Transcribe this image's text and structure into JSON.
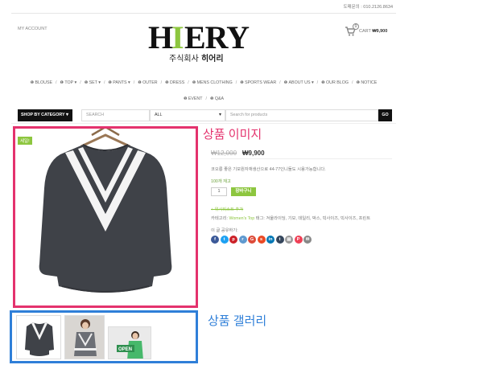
{
  "topbar": {
    "contact": "도매문의 : 010.2126.8634"
  },
  "header": {
    "my_account": "MY ACCOUNT",
    "logo_text": "HIERY",
    "logo_sub": "주식회사 히어리",
    "cart_badge": "0",
    "cart_label": "CART",
    "cart_total": "₩9,900"
  },
  "nav": {
    "items": [
      {
        "label": "BLOUSE",
        "chevron": false
      },
      {
        "label": "TOP",
        "chevron": true
      },
      {
        "label": "SET",
        "chevron": true
      },
      {
        "label": "PANTS",
        "chevron": true
      },
      {
        "label": "OUTER",
        "chevron": false
      },
      {
        "label": "DRESS",
        "chevron": false
      },
      {
        "label": "MENS CLOTHING",
        "chevron": false
      },
      {
        "label": "SPORTS WEAR",
        "chevron": false
      },
      {
        "label": "ABOUT US",
        "chevron": true
      },
      {
        "label": "OUR BLOG",
        "chevron": false
      },
      {
        "label": "NOTICE",
        "chevron": false
      },
      {
        "label": "EVENT",
        "chevron": false
      },
      {
        "label": "Q&A",
        "chevron": false
      }
    ]
  },
  "search": {
    "category_button": "SHOP BY CATEGORY",
    "search_label": "SEARCH",
    "scope": "ALL",
    "placeholder": "Search for products",
    "go": "GO"
  },
  "product": {
    "sale_badge": "세일!",
    "old_price": "₩12,000",
    "new_price": "₩9,900",
    "description": "코오롱 좋은 기모원자재생산으로 44-77인니둘도 시용가능합니다.",
    "stock": "100개 재고",
    "quantity": "1",
    "buy_button": "장바구니",
    "wishlist": "+ 위시리스트 추가",
    "categories_prefix": "카테고리: ",
    "categories_link": "Women's Top",
    "tags": " 태그: 겨울라이딩, 기모, 데일리, 박스, 빅사이즈, 빅사이즈, 프린트",
    "share_label": "이 글 공유하기:"
  },
  "social": [
    {
      "icon": "facebook-icon",
      "glyph": "f",
      "color": "#3b5998"
    },
    {
      "icon": "twitter-icon",
      "glyph": "t",
      "color": "#1da1f2"
    },
    {
      "icon": "pinterest-icon",
      "glyph": "p",
      "color": "#cb2027"
    },
    {
      "icon": "reddit-icon",
      "glyph": "r",
      "color": "#5f99cf"
    },
    {
      "icon": "googleplus-icon",
      "glyph": "G",
      "color": "#dd4b39"
    },
    {
      "icon": "stumbleupon-icon",
      "glyph": "s",
      "color": "#eb4924"
    },
    {
      "icon": "linkedin-icon",
      "glyph": "in",
      "color": "#0077b5"
    },
    {
      "icon": "tumblr-icon",
      "glyph": "t",
      "color": "#35465c"
    },
    {
      "icon": "print-icon",
      "glyph": "▤",
      "color": "#999999"
    },
    {
      "icon": "pocket-icon",
      "glyph": "P",
      "color": "#ef4056"
    },
    {
      "icon": "email-icon",
      "glyph": "✉",
      "color": "#888888"
    }
  ],
  "annotations": {
    "image_label": "상품 이미지",
    "gallery_label": "상품 갤러리",
    "image_color": "#e4326d",
    "gallery_color": "#2f7fd8"
  }
}
